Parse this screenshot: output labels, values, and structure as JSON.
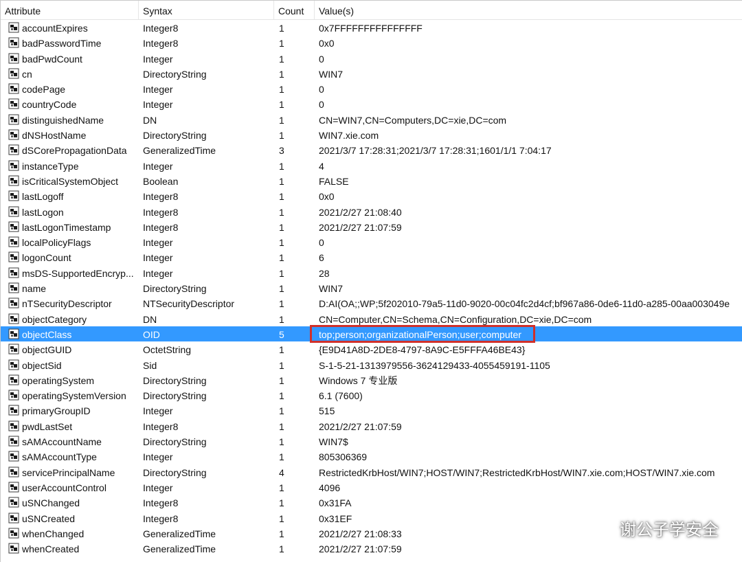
{
  "columns": {
    "attribute": "Attribute",
    "syntax": "Syntax",
    "count": "Count",
    "values": "Value(s)"
  },
  "rows": [
    {
      "attribute": "accountExpires",
      "syntax": "Integer8",
      "count": "1",
      "value": "0x7FFFFFFFFFFFFFFF"
    },
    {
      "attribute": "badPasswordTime",
      "syntax": "Integer8",
      "count": "1",
      "value": "0x0"
    },
    {
      "attribute": "badPwdCount",
      "syntax": "Integer",
      "count": "1",
      "value": "0"
    },
    {
      "attribute": "cn",
      "syntax": "DirectoryString",
      "count": "1",
      "value": "WIN7"
    },
    {
      "attribute": "codePage",
      "syntax": "Integer",
      "count": "1",
      "value": "0"
    },
    {
      "attribute": "countryCode",
      "syntax": "Integer",
      "count": "1",
      "value": "0"
    },
    {
      "attribute": "distinguishedName",
      "syntax": "DN",
      "count": "1",
      "value": "CN=WIN7,CN=Computers,DC=xie,DC=com"
    },
    {
      "attribute": "dNSHostName",
      "syntax": "DirectoryString",
      "count": "1",
      "value": "WIN7.xie.com"
    },
    {
      "attribute": "dSCorePropagationData",
      "syntax": "GeneralizedTime",
      "count": "3",
      "value": "2021/3/7 17:28:31;2021/3/7 17:28:31;1601/1/1 7:04:17"
    },
    {
      "attribute": "instanceType",
      "syntax": "Integer",
      "count": "1",
      "value": "4"
    },
    {
      "attribute": "isCriticalSystemObject",
      "syntax": "Boolean",
      "count": "1",
      "value": "FALSE"
    },
    {
      "attribute": "lastLogoff",
      "syntax": "Integer8",
      "count": "1",
      "value": "0x0"
    },
    {
      "attribute": "lastLogon",
      "syntax": "Integer8",
      "count": "1",
      "value": "2021/2/27 21:08:40"
    },
    {
      "attribute": "lastLogonTimestamp",
      "syntax": "Integer8",
      "count": "1",
      "value": "2021/2/27 21:07:59"
    },
    {
      "attribute": "localPolicyFlags",
      "syntax": "Integer",
      "count": "1",
      "value": "0"
    },
    {
      "attribute": "logonCount",
      "syntax": "Integer",
      "count": "1",
      "value": "6"
    },
    {
      "attribute": "msDS-SupportedEncryp...",
      "syntax": "Integer",
      "count": "1",
      "value": "28"
    },
    {
      "attribute": "name",
      "syntax": "DirectoryString",
      "count": "1",
      "value": "WIN7"
    },
    {
      "attribute": "nTSecurityDescriptor",
      "syntax": "NTSecurityDescriptor",
      "count": "1",
      "value": "D:AI(OA;;WP;5f202010-79a5-11d0-9020-00c04fc2d4cf;bf967a86-0de6-11d0-a285-00aa003049e"
    },
    {
      "attribute": "objectCategory",
      "syntax": "DN",
      "count": "1",
      "value": "CN=Computer,CN=Schema,CN=Configuration,DC=xie,DC=com"
    },
    {
      "attribute": "objectClass",
      "syntax": "OID",
      "count": "5",
      "value": "top;person;organizationalPerson;user;computer",
      "selected": true
    },
    {
      "attribute": "objectGUID",
      "syntax": "OctetString",
      "count": "1",
      "value": "{E9D41A8D-2DE8-4797-8A9C-E5FFFA46BE43}"
    },
    {
      "attribute": "objectSid",
      "syntax": "Sid",
      "count": "1",
      "value": "S-1-5-21-1313979556-3624129433-4055459191-1105"
    },
    {
      "attribute": "operatingSystem",
      "syntax": "DirectoryString",
      "count": "1",
      "value": "Windows 7 专业版"
    },
    {
      "attribute": "operatingSystemVersion",
      "syntax": "DirectoryString",
      "count": "1",
      "value": "6.1 (7600)"
    },
    {
      "attribute": "primaryGroupID",
      "syntax": "Integer",
      "count": "1",
      "value": "515"
    },
    {
      "attribute": "pwdLastSet",
      "syntax": "Integer8",
      "count": "1",
      "value": "2021/2/27 21:07:59"
    },
    {
      "attribute": "sAMAccountName",
      "syntax": "DirectoryString",
      "count": "1",
      "value": "WIN7$"
    },
    {
      "attribute": "sAMAccountType",
      "syntax": "Integer",
      "count": "1",
      "value": "805306369"
    },
    {
      "attribute": "servicePrincipalName",
      "syntax": "DirectoryString",
      "count": "4",
      "value": "RestrictedKrbHost/WIN7;HOST/WIN7;RestrictedKrbHost/WIN7.xie.com;HOST/WIN7.xie.com"
    },
    {
      "attribute": "userAccountControl",
      "syntax": "Integer",
      "count": "1",
      "value": "4096"
    },
    {
      "attribute": "uSNChanged",
      "syntax": "Integer8",
      "count": "1",
      "value": "0x31FA"
    },
    {
      "attribute": "uSNCreated",
      "syntax": "Integer8",
      "count": "1",
      "value": "0x31EF"
    },
    {
      "attribute": "whenChanged",
      "syntax": "GeneralizedTime",
      "count": "1",
      "value": "2021/2/27 21:08:33"
    },
    {
      "attribute": "whenCreated",
      "syntax": "GeneralizedTime",
      "count": "1",
      "value": "2021/2/27 21:07:59"
    }
  ],
  "row_icon": "attribute-icon",
  "selection_color": "#3399ff",
  "highlight_color": "#d0302a",
  "watermark": {
    "text": "谢公子学安全",
    "icon": "wechat-icon"
  }
}
